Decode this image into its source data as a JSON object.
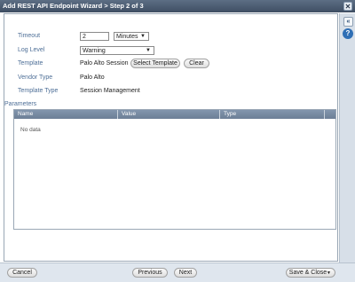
{
  "window": {
    "title": "Add REST API Endpoint Wizard > Step 2 of 3",
    "close_glyph": "✕"
  },
  "side": {
    "collapse_glyph": "«",
    "help_glyph": "?"
  },
  "form": {
    "timeout_label": "Timeout",
    "timeout_value": "2",
    "timeout_unit": "Minutes",
    "loglevel_label": "Log Level",
    "loglevel_value": "Warning",
    "template_label": "Template",
    "template_value": "Palo Alto Session",
    "select_template_label": "Select Template",
    "clear_label": "Clear",
    "vendor_label": "Vendor Type",
    "vendor_value": "Palo Alto",
    "template_type_label": "Template Type",
    "template_type_value": "Session Management"
  },
  "parameters": {
    "label": "Parameters",
    "columns": [
      "Name",
      "Value",
      "Type"
    ],
    "empty_text": "No data"
  },
  "footer": {
    "cancel_label": "Cancel",
    "previous_label": "Previous",
    "next_label": "Next",
    "save_close_label": "Save & Close"
  },
  "icons": {
    "dropdown": "chevron-down-icon"
  }
}
